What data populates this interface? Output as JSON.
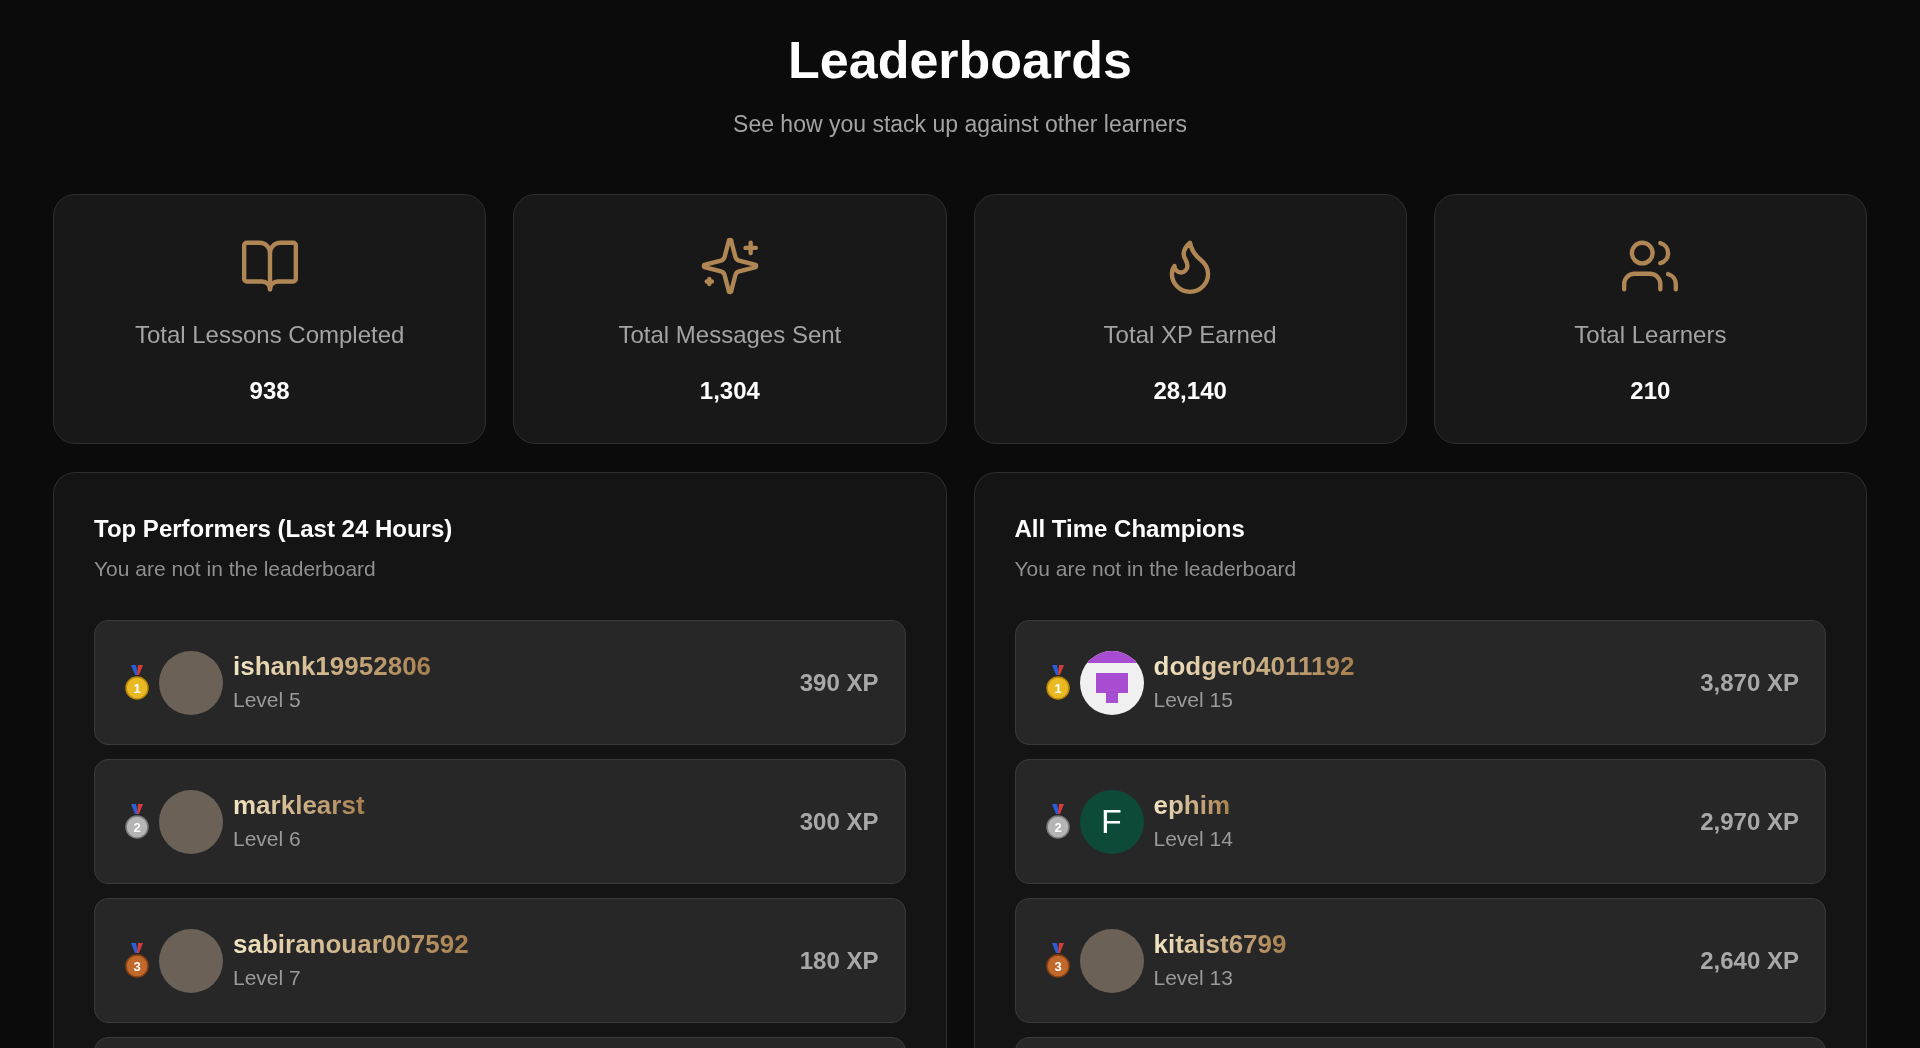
{
  "header": {
    "title": "Leaderboards",
    "subtitle": "See how you stack up against other learners"
  },
  "stats": [
    {
      "kind": "book",
      "label": "Total Lessons Completed",
      "value": "938"
    },
    {
      "kind": "sparkles",
      "label": "Total Messages Sent",
      "value": "1,304"
    },
    {
      "kind": "flame",
      "label": "Total XP Earned",
      "value": "28,140"
    },
    {
      "kind": "users",
      "label": "Total Learners",
      "value": "210"
    }
  ],
  "boards": [
    {
      "title": "Top Performers (Last 24 Hours)",
      "subtitle": "You are not in the leaderboard",
      "rows": [
        {
          "rank": "1",
          "avatar": {
            "kind": "photo"
          },
          "username": "ishank19952806",
          "level": "Level 5",
          "xp": "390 XP"
        },
        {
          "rank": "2",
          "avatar": {
            "kind": "photo"
          },
          "username": "marklearst",
          "level": "Level 6",
          "xp": "300 XP"
        },
        {
          "rank": "3",
          "avatar": {
            "kind": "photo"
          },
          "username": "sabiranouar007592",
          "level": "Level 7",
          "xp": "180 XP"
        }
      ]
    },
    {
      "title": "All Time Champions",
      "subtitle": "You are not in the leaderboard",
      "rows": [
        {
          "rank": "1",
          "avatar": {
            "kind": "identicon"
          },
          "username": "dodger04011192",
          "level": "Level 15",
          "xp": "3,870 XP"
        },
        {
          "rank": "2",
          "avatar": {
            "kind": "letter",
            "letter": "F",
            "color": "#0d4a3a"
          },
          "username": "ephim",
          "level": "Level 14",
          "xp": "2,970 XP"
        },
        {
          "rank": "3",
          "avatar": {
            "kind": "photo"
          },
          "username": "kitaist6799",
          "level": "Level 13",
          "xp": "2,640 XP"
        }
      ]
    }
  ]
}
